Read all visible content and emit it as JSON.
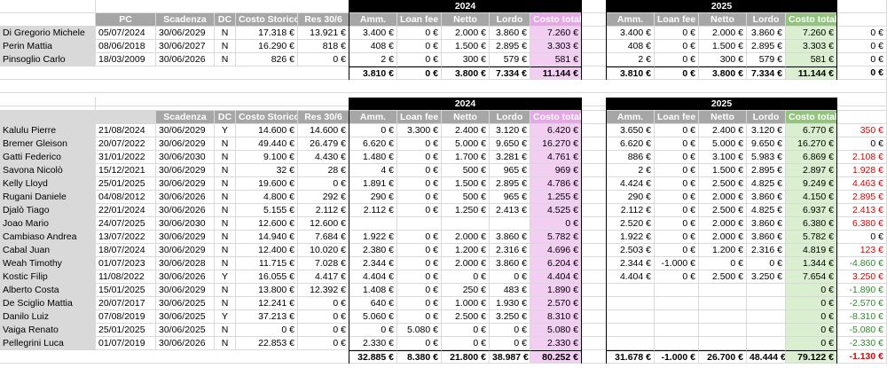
{
  "table1": {
    "header_pc": "PC",
    "header_scadenza": "Scadenza",
    "header_dc": "DC",
    "header_costo_storico": "Costo Storico",
    "header_res": "Res 30/6",
    "header_2024": "2024",
    "header_2025": "2025",
    "sub": [
      "Amm.",
      "Loan fee",
      "Netto",
      "Lordo",
      "Costo totale"
    ],
    "rows": [
      {
        "name": "Di Gregorio Michele",
        "pc": "05/07/2024",
        "scadenza": "30/06/2029",
        "dc": "N",
        "costo": "17.318 €",
        "res": "13.921 €",
        "y24": [
          "3.400 €",
          "0 €",
          "2.000 €",
          "3.860 €",
          "7.260 €"
        ],
        "y25": [
          "3.400 €",
          "0 €",
          "2.000 €",
          "3.860 €",
          "7.260 €"
        ],
        "diff": "0 €"
      },
      {
        "name": "Perin Mattia",
        "pc": "08/06/2018",
        "scadenza": "30/06/2027",
        "dc": "N",
        "costo": "16.290 €",
        "res": "818 €",
        "y24": [
          "408 €",
          "0 €",
          "1.500 €",
          "2.895 €",
          "3.303 €"
        ],
        "y25": [
          "408 €",
          "0 €",
          "1.500 €",
          "2.895 €",
          "3.303 €"
        ],
        "diff": "0 €"
      },
      {
        "name": "Pinsoglio Carlo",
        "pc": "18/03/2009",
        "scadenza": "30/06/2026",
        "dc": "N",
        "costo": "826 €",
        "res": "0 €",
        "y24": [
          "2 €",
          "0 €",
          "300 €",
          "579 €",
          "581 €"
        ],
        "y25": [
          "2 €",
          "0 €",
          "300 €",
          "579 €",
          "581 €"
        ],
        "diff": "0 €"
      }
    ],
    "totals24": [
      "3.810 €",
      "0 €",
      "3.800 €",
      "7.334 €",
      "11.144 €"
    ],
    "totals25": [
      "3.810 €",
      "0 €",
      "3.800 €",
      "7.334 €",
      "11.144 €"
    ],
    "totaldiff": "0 €"
  },
  "table2": {
    "header_scadenza": "Scadenza",
    "header_dc": "DC",
    "header_costo_storico": "Costo Storico",
    "header_res": "Res 30/6",
    "header_2024": "2024",
    "header_2025": "2025",
    "sub": [
      "Amm.",
      "Loan fee",
      "Netto",
      "Lordo",
      "Costo totale"
    ],
    "rows": [
      {
        "name": "Kalulu Pierre",
        "pc": "21/08/2024",
        "scadenza": "30/06/2029",
        "dc": "Y",
        "costo": "14.600 €",
        "res": "14.600 €",
        "y24": [
          "0 €",
          "3.300 €",
          "2.400 €",
          "3.120 €",
          "6.420 €"
        ],
        "y25": [
          "3.650 €",
          "0 €",
          "2.400 €",
          "3.120 €",
          "6.770 €"
        ],
        "diff": "350 €",
        "dc_color": "red"
      },
      {
        "name": "Bremer Gleison",
        "pc": "20/07/2022",
        "scadenza": "30/06/2029",
        "dc": "N",
        "costo": "49.440 €",
        "res": "26.479 €",
        "y24": [
          "6.620 €",
          "0 €",
          "5.000 €",
          "9.650 €",
          "16.270 €"
        ],
        "y25": [
          "6.620 €",
          "0 €",
          "5.000 €",
          "9.650 €",
          "16.270 €"
        ],
        "diff": "0 €",
        "dc_color": "black"
      },
      {
        "name": "Gatti Federico",
        "pc": "31/01/2022",
        "scadenza": "30/06/2030",
        "dc": "N",
        "costo": "9.100 €",
        "res": "4.430 €",
        "y24": [
          "1.480 €",
          "0 €",
          "1.700 €",
          "3.281 €",
          "4.761 €"
        ],
        "y25": [
          "886 €",
          "0 €",
          "3.100 €",
          "5.983 €",
          "6.869 €"
        ],
        "diff": "2.108 €",
        "dc_color": "red"
      },
      {
        "name": "Savona Nicolò",
        "pc": "15/12/2021",
        "scadenza": "30/06/2029",
        "dc": "N",
        "costo": "32 €",
        "res": "28 €",
        "y24": [
          "4 €",
          "0 €",
          "500 €",
          "965 €",
          "969 €"
        ],
        "y25": [
          "2 €",
          "0 €",
          "1.500 €",
          "2.895 €",
          "2.897 €"
        ],
        "diff": "1.928 €",
        "dc_color": "red"
      },
      {
        "name": "Kelly Lloyd",
        "pc": "25/01/2025",
        "scadenza": "30/06/2029",
        "dc": "N",
        "costo": "19.600 €",
        "res": "0 €",
        "y24": [
          "1.891 €",
          "0 €",
          "1.500 €",
          "2.895 €",
          "4.786 €"
        ],
        "y25": [
          "4.424 €",
          "0 €",
          "2.500 €",
          "4.825 €",
          "9.249 €"
        ],
        "diff": "4.463 €",
        "dc_color": "red"
      },
      {
        "name": "Rugani Daniele",
        "pc": "04/08/2012",
        "scadenza": "30/06/2026",
        "dc": "N",
        "costo": "4.800 €",
        "res": "292 €",
        "y24": [
          "290 €",
          "0 €",
          "500 €",
          "965 €",
          "1.255 €"
        ],
        "y25": [
          "290 €",
          "0 €",
          "2.000 €",
          "3.860 €",
          "4.150 €"
        ],
        "diff": "2.895 €",
        "dc_color": "red"
      },
      {
        "name": "Djalò Tiago",
        "pc": "22/01/2024",
        "scadenza": "30/06/2026",
        "dc": "N",
        "costo": "5.155 €",
        "res": "2.112 €",
        "y24": [
          "2.112 €",
          "0 €",
          "1.250 €",
          "2.413 €",
          "4.525 €"
        ],
        "y25": [
          "2.112 €",
          "0 €",
          "2.500 €",
          "4.825 €",
          "6.937 €"
        ],
        "diff": "2.413 €",
        "dc_color": "red"
      },
      {
        "name": "Joao Mario",
        "pc": "24/07/2025",
        "scadenza": "30/06/2030",
        "dc": "N",
        "costo": "12.600 €",
        "res": "12.600 €",
        "y24": [
          "",
          "",
          "",
          "",
          "0 €"
        ],
        "y25": [
          "2.520 €",
          "0 €",
          "2.000 €",
          "3.860 €",
          "6.380 €"
        ],
        "diff": "6.380 €",
        "dc_color": "red"
      },
      {
        "name": "Cambiaso Andrea",
        "pc": "13/07/2022",
        "scadenza": "30/06/2029",
        "dc": "N",
        "costo": "14.940 €",
        "res": "7.684 €",
        "y24": [
          "1.922 €",
          "0 €",
          "2.000 €",
          "3.860 €",
          "5.782 €"
        ],
        "y25": [
          "1.922 €",
          "0 €",
          "2.000 €",
          "3.860 €",
          "5.782 €"
        ],
        "diff": "0 €",
        "dc_color": "black"
      },
      {
        "name": "Cabal Juan",
        "pc": "18/07/2024",
        "scadenza": "30/06/2029",
        "dc": "N",
        "costo": "12.400 €",
        "res": "10.020 €",
        "y24": [
          "2.380 €",
          "0 €",
          "1.200 €",
          "2.316 €",
          "4.696 €"
        ],
        "y25": [
          "2.503 €",
          "0 €",
          "1.200 €",
          "2.316 €",
          "4.819 €"
        ],
        "diff": "123 €",
        "dc_color": "red"
      },
      {
        "name": "Weah Timothy",
        "pc": "01/07/2023",
        "scadenza": "30/06/2028",
        "dc": "N",
        "costo": "11.715 €",
        "res": "7.028 €",
        "y24": [
          "2.344 €",
          "0 €",
          "2.000 €",
          "3.860 €",
          "6.204 €"
        ],
        "y25": [
          "2.344 €",
          "-1.000 €",
          "0 €",
          "0 €",
          "1.344 €"
        ],
        "diff": "-4.860 €",
        "dc_color": "green"
      },
      {
        "name": "Kostic Filip",
        "pc": "11/08/2022",
        "scadenza": "30/06/2026",
        "dc": "Y",
        "costo": "16.055 €",
        "res": "4.417 €",
        "y24": [
          "4.404 €",
          "0 €",
          "0 €",
          "0 €",
          "4.404 €"
        ],
        "y25": [
          "4.404 €",
          "0 €",
          "2.500 €",
          "3.250 €",
          "7.654 €"
        ],
        "diff": "3.250 €",
        "dc_color": "red"
      },
      {
        "name": "Alberto Costa",
        "pc": "15/01/2025",
        "scadenza": "30/06/2029",
        "dc": "N",
        "costo": "13.800 €",
        "res": "12.392 €",
        "y24": [
          "1.408 €",
          "0 €",
          "250 €",
          "483 €",
          "1.890 €"
        ],
        "y25": [
          "",
          "",
          "",
          "",
          "0 €"
        ],
        "diff": "-1.890 €",
        "dc_color": "green"
      },
      {
        "name": "De Sciglio Mattia",
        "pc": "20/07/2017",
        "scadenza": "30/06/2025",
        "dc": "N",
        "costo": "12.241 €",
        "res": "0 €",
        "y24": [
          "640 €",
          "0 €",
          "1.000 €",
          "1.930 €",
          "2.570 €"
        ],
        "y25": [
          "",
          "",
          "",
          "",
          "0 €"
        ],
        "diff": "-2.570 €",
        "dc_color": "green"
      },
      {
        "name": "Danilo Luiz",
        "pc": "07/08/2019",
        "scadenza": "30/06/2025",
        "dc": "Y",
        "costo": "37.213 €",
        "res": "0 €",
        "y24": [
          "5.060 €",
          "0 €",
          "2.500 €",
          "3.250 €",
          "8.310 €"
        ],
        "y25": [
          "",
          "",
          "",
          "",
          "0 €"
        ],
        "diff": "-8.310 €",
        "dc_color": "green"
      },
      {
        "name": "Vaiga Renato",
        "pc": "25/01/2025",
        "scadenza": "30/06/2025",
        "dc": "N",
        "costo": "0 €",
        "res": "0 €",
        "y24": [
          "0 €",
          "5.080 €",
          "0 €",
          "0 €",
          "5.080 €"
        ],
        "y25": [
          "",
          "",
          "",
          "",
          "0 €"
        ],
        "diff": "-5.080 €",
        "dc_color": "green"
      },
      {
        "name": "Pellegrini Luca",
        "pc": "01/07/2019",
        "scadenza": "30/06/2026",
        "dc": "N",
        "costo": "22.853 €",
        "res": "0 €",
        "y24": [
          "2.330 €",
          "0 €",
          "0 €",
          "0 €",
          "2.330 €"
        ],
        "y25": [
          "",
          "",
          "",
          "",
          "0 €"
        ],
        "diff": "-2.330 €",
        "dc_color": "green"
      }
    ],
    "totals24": [
      "32.885 €",
      "8.380 €",
      "21.800 €",
      "38.987 €",
      "80.252 €"
    ],
    "totals25": [
      "31.678 €",
      "-1.000 €",
      "26.700 €",
      "48.444 €",
      "79.122 €"
    ],
    "totaldiff": "-1.130 €"
  },
  "colors": {
    "pink": "#f2cef2",
    "green": "#d9efd0",
    "header_grey": "#a6a6a6",
    "red": "#e00000",
    "green_text": "#2e8b2e"
  }
}
